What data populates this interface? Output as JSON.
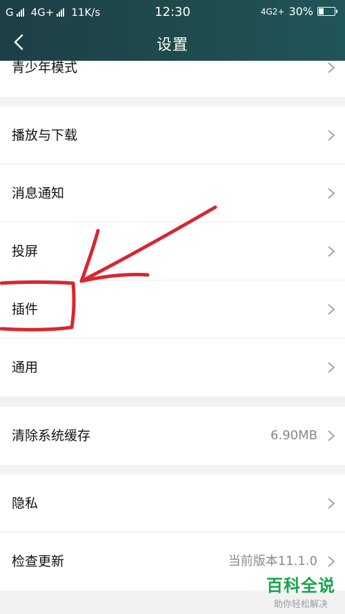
{
  "status_bar": {
    "carrier1": "G",
    "carrier2": "4G+",
    "speed": "11K/s",
    "time": "12:30",
    "network": "4G2+",
    "battery": "30%",
    "battery_level": 0.3
  },
  "header": {
    "title": "设置"
  },
  "rows": [
    {
      "label": "青少年模式",
      "value": ""
    },
    {
      "label": "播放与下载",
      "value": ""
    },
    {
      "label": "消息通知",
      "value": ""
    },
    {
      "label": "投屏",
      "value": ""
    },
    {
      "label": "插件",
      "value": ""
    },
    {
      "label": "通用",
      "value": ""
    },
    {
      "label": "清除系统缓存",
      "value": "6.90MB"
    },
    {
      "label": "隐私",
      "value": ""
    },
    {
      "label": "检查更新",
      "value": "当前版本11.1.0"
    }
  ],
  "watermark": {
    "title": "百科全说",
    "subtitle": "助你轻松解决"
  },
  "colors": {
    "header": "#1f4a4c",
    "annotation": "#d9262f",
    "watermark": "#16a34a"
  }
}
